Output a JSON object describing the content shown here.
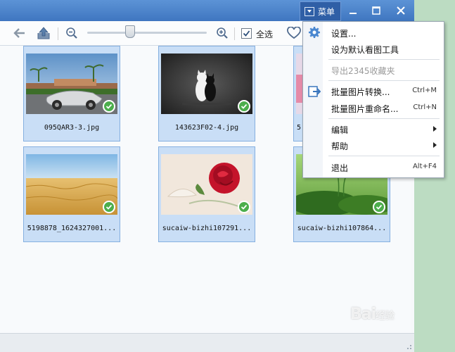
{
  "titlebar": {
    "menu_label": "菜单",
    "minimize_icon": "minimize-icon",
    "maximize_icon": "maximize-icon",
    "close_icon": "close-icon"
  },
  "toolbar": {
    "back_icon": "back-arrow-icon",
    "export_icon": "export-icon",
    "zoom_out_icon": "zoom-out-icon",
    "zoom_in_icon": "zoom-in-icon",
    "zoom_level": 0.35,
    "select_all_label": "全选",
    "select_all_checked": true,
    "favorite_icon": "heart-icon"
  },
  "thumbnails": [
    {
      "caption": "095QAR3-3.jpg",
      "checked": true,
      "scene": "sports-car"
    },
    {
      "caption": "143623F02-4.jpg",
      "checked": true,
      "scene": "cats"
    },
    {
      "caption": "5",
      "checked": true,
      "scene": "pink"
    },
    {
      "caption": "5198878_1624327001...",
      "checked": true,
      "scene": "wheat-field"
    },
    {
      "caption": "sucaiw-bizhi107291...",
      "checked": true,
      "scene": "rose"
    },
    {
      "caption": "sucaiw-bizhi107864...",
      "checked": true,
      "scene": "grass"
    }
  ],
  "menu": {
    "items": [
      {
        "label": "设置...",
        "shortcut": "",
        "disabled": false,
        "submenu": false
      },
      {
        "label": "设为默认看图工具",
        "shortcut": "",
        "disabled": false,
        "submenu": false
      },
      {
        "label": "导出2345收藏夹",
        "shortcut": "",
        "disabled": true,
        "submenu": false
      },
      {
        "label": "批量图片转换...",
        "shortcut": "Ctrl+M",
        "disabled": false,
        "submenu": false
      },
      {
        "label": "批量图片重命名...",
        "shortcut": "Ctrl+N",
        "disabled": false,
        "submenu": false
      },
      {
        "label": "编辑",
        "shortcut": "",
        "disabled": false,
        "submenu": true
      },
      {
        "label": "帮助",
        "shortcut": "",
        "disabled": false,
        "submenu": true
      },
      {
        "label": "退出",
        "shortcut": "Alt+F4",
        "disabled": false,
        "submenu": false
      }
    ]
  },
  "watermark": {
    "text": "Bai",
    "suffix": "经验"
  },
  "colors": {
    "titlebar": "#3f76c0",
    "selection": "#c9def6",
    "check_badge": "#4cae4c",
    "background_green": "#bcdcc2"
  }
}
